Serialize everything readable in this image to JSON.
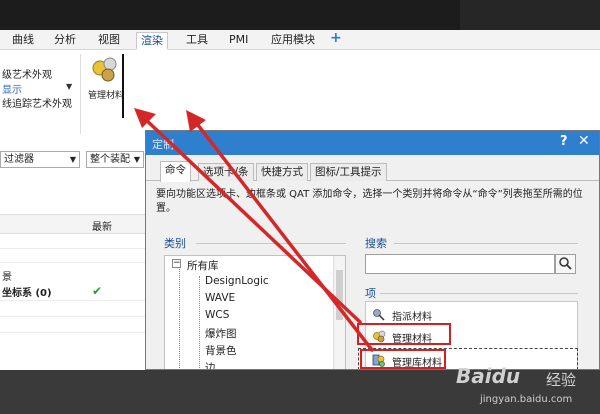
{
  "ribbon": {
    "tabs": [
      "曲线",
      "分析",
      "视图",
      "渲染",
      "工具",
      "PMI",
      "应用模块"
    ],
    "active_tab": "渲染",
    "add_tab_icon": "plus-icon",
    "items": [
      "级艺术外观",
      "线追踪艺术外观"
    ],
    "group_label": "显示",
    "manage_materials_label": "管理材料"
  },
  "left_panel": {
    "filter_label": "过滤器",
    "assembly_label": "整个装配",
    "column_latest": "最新",
    "items": [
      "景",
      "坐标系 (0)"
    ]
  },
  "dialog": {
    "title": "定制",
    "tabs": [
      "命令",
      "选项卡/条",
      "快捷方式",
      "图标/工具提示"
    ],
    "active_tab": "命令",
    "description": "要向功能区选项卡、边框条或 QAT 添加命令，选择一个类别并将命令从“命令”列表拖至所需的位置。",
    "category_label": "类别",
    "tree_root": "所有库",
    "tree_items": [
      "DesignLogic",
      "WAVE",
      "WCS",
      "爆炸图",
      "背景色",
      "边"
    ],
    "search_label": "搜索",
    "search_value": "",
    "items_label": "项",
    "items": [
      "指派材料",
      "管理材料",
      "管理库材料"
    ]
  },
  "watermark": {
    "logo": "Baidu",
    "cn": "经验",
    "url": "jingyan.baidu.com"
  },
  "colors": {
    "accent": "#2f7fcf",
    "highlight": "#d42020",
    "check": "#2e9a2e",
    "arrow": "#d42828"
  }
}
